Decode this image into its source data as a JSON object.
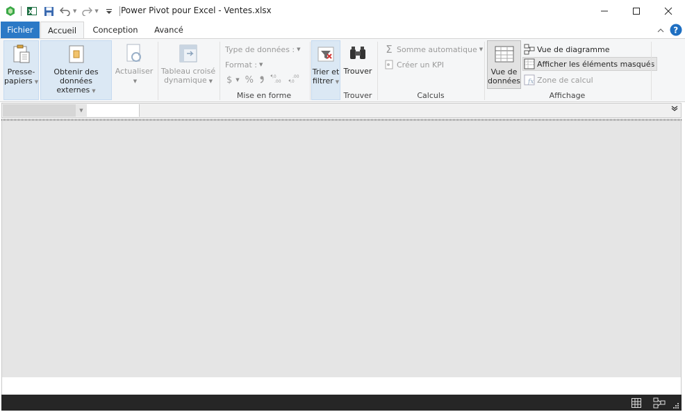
{
  "window": {
    "title": "Power Pivot pour Excel - Ventes.xlsx"
  },
  "tabs": {
    "file": "Fichier",
    "home": "Accueil",
    "design": "Conception",
    "advanced": "Avancé"
  },
  "ribbon": {
    "clipboard": {
      "line1": "Presse-",
      "line2": "papiers"
    },
    "external": {
      "line1": "Obtenir des",
      "line2": "données externes"
    },
    "refresh": {
      "label": "Actualiser"
    },
    "pivot": {
      "line1": "Tableau croisé",
      "line2": "dynamique"
    },
    "formatting": {
      "data_type": "Type de données :",
      "format": "Format :",
      "currency": "$",
      "percent": "%",
      "comma": "9",
      "inc_decimals": "←,0 .00",
      "dec_decimals": ".00 →,0",
      "group_label": "Mise en forme"
    },
    "sort": {
      "line1": "Trier et",
      "line2": "filtrer"
    },
    "find": {
      "label": "Trouver",
      "group_label": "Trouver"
    },
    "calculations": {
      "autosum": "Somme automatique",
      "kpi": "Créer un KPI",
      "group_label": "Calculs"
    },
    "view": {
      "data_view_line1": "Vue de",
      "data_view_line2": "données",
      "diagram_view": "Vue de diagramme",
      "show_hidden": "Afficher les éléments masqués",
      "calc_area": "Zone de calcul",
      "group_label": "Affichage"
    }
  },
  "colors": {
    "file_tab": "#2b79c6",
    "status_bar": "#262626",
    "grid_bg": "#e5e5e5",
    "help": "#1e6fc2"
  }
}
